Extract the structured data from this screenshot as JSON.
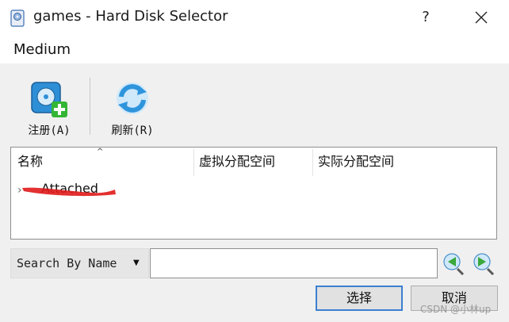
{
  "window": {
    "title": "games - Hard Disk Selector",
    "help": "?"
  },
  "menu": {
    "medium": "Medium"
  },
  "toolbar": {
    "register_label": "注册(A)",
    "refresh_label": "刷新(R)"
  },
  "list": {
    "columns": [
      "名称",
      "虚拟分配空间",
      "实际分配空间"
    ],
    "rows": [
      {
        "name": "Attached"
      }
    ]
  },
  "search": {
    "mode": "Search By Name",
    "value": ""
  },
  "buttons": {
    "choose": "选择",
    "cancel": "取消"
  },
  "watermark": "CSDN @小林up",
  "colors": {
    "accent": "#3c7fd1",
    "scribble": "#e0191a",
    "nav_green": "#3aa83a"
  },
  "icons": {
    "app": "disk-icon",
    "register": "add-disk-icon",
    "refresh": "refresh-icon",
    "prev": "arrow-left-icon",
    "next": "arrow-right-icon"
  }
}
